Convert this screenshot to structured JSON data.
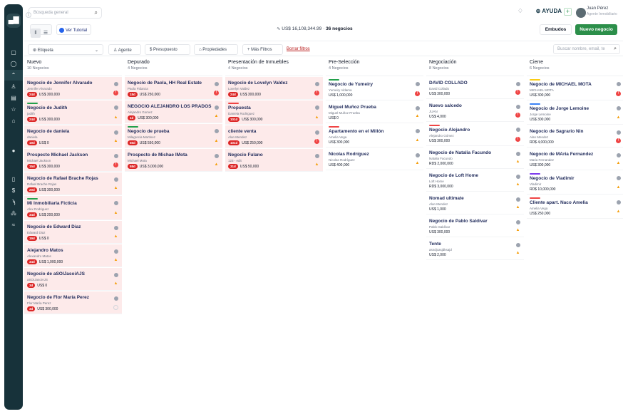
{
  "sidebar": {
    "logo_label": "▄▇",
    "collapse_icon": "chevron-right-icon"
  },
  "header": {
    "search_placeholder": "Búsqueda general",
    "help_label": "AYUDA",
    "user_name": "Juan Pérez",
    "user_role": "Agente Inmobiliario"
  },
  "toolbar": {
    "tutorial_label": "Ver Tutorial",
    "total_value": "US$ 16,108,344.99",
    "total_separator": "·",
    "deal_count": "36 negocios",
    "embudos_label": "Embudos",
    "new_deal_label": "Nuevo negocio"
  },
  "filters": {
    "etiqueta": "Etiqueta",
    "agente": "Agente",
    "presupuesto": "Presupuesto",
    "propiedades": "Propiedades",
    "mas_filtros": "+ Más Filtros",
    "borrar": "Borrar filtros",
    "search_placeholder": "Buscar nombre, email, te"
  },
  "columns": [
    {
      "name": "Nuevo",
      "count": "10 Negocios",
      "cards": [
        {
          "title": "Negocio de Jennifer Alvarado",
          "sub": "Jennifer Alvarado",
          "tag": "24d",
          "value": "US$ 300,000",
          "status": "error",
          "red": true
        },
        {
          "title": "Negocio de Judith",
          "sub": "judith",
          "tag": "24d",
          "value": "US$ 300,000",
          "status": "warn",
          "red": true,
          "bar": "#22a04b"
        },
        {
          "title": "Negocio de daniela",
          "sub": "daniela",
          "tag": "19d",
          "value": "US$ 0",
          "status": "warn",
          "red": true
        },
        {
          "title": "Prospecto Michael Jackson",
          "sub": "Michael Jackson",
          "tag": "15d",
          "value": "US$ 300,000",
          "status": "error",
          "red": true
        },
        {
          "title": "Negocio de Rafael Brache Rojas",
          "sub": "Rafael Brache Rojas",
          "tag": "20d",
          "value": "US$ 300,000",
          "status": "warn",
          "red": true
        },
        {
          "title": "Mi Inmobiliaria Ficticia",
          "sub": "Alex Rodriguez",
          "tag": "34d",
          "value": "US$ 200,000",
          "status": "warn",
          "red": true,
          "bar": "#22a04b"
        },
        {
          "title": "Negocio de Edward Diaz",
          "sub": "Edward Diaz",
          "tag": "19d",
          "value": "US$ 0",
          "status": "warn",
          "red": true
        },
        {
          "title": "Alejandro Matos",
          "sub": "Alexandro Matos",
          "tag": "34d",
          "value": "US$ 1,000,000",
          "status": "warn",
          "red": true
        },
        {
          "title": "Negocio de aSOIJasoiAJS",
          "sub": "aSOIJasoiAJS",
          "tag": "3d",
          "value": "US$ 0",
          "status": "warn",
          "red": true
        },
        {
          "title": "Negocio de Flor María Perez",
          "sub": "Flor María Perez",
          "tag": "3d",
          "value": "US$ 300,000",
          "status": "ok",
          "red": true
        }
      ]
    },
    {
      "name": "Depurado",
      "count": "4 Negocios",
      "cards": [
        {
          "title": "Negocio de Paola, HH Real Estate",
          "sub": "Paola Fidanza",
          "tag": "18d",
          "value": "US$ 250,000",
          "status": "error",
          "red": true
        },
        {
          "title": "NEGOCIO ALEJANDRO LOS PRADOS",
          "sub": "Alejandro Gomez",
          "tag": "1d",
          "value": "US$ 300,000",
          "status": "warn",
          "red": true
        },
        {
          "title": "Negocio de prueba",
          "sub": "Milagrecia Martinez",
          "tag": "55d",
          "value": "US$ 550,000",
          "status": "warn",
          "red": true,
          "bar": "#22a04b"
        },
        {
          "title": "Prospecto de Michae lMota",
          "sub": "Michael Mota",
          "tag": "58d",
          "value": "US$ 3,000,000",
          "status": "warn",
          "red": true
        }
      ]
    },
    {
      "name": "Presentación de Inmuebles",
      "count": "4 Negocios",
      "cards": [
        {
          "title": "Negocio de Lovelyn Valdez",
          "sub": "Lovelyn Valdez",
          "tag": "24d",
          "value": "US$ 300,000",
          "status": "error",
          "red": true
        },
        {
          "title": "Propuesta",
          "sub": "Daniela Rodriguez",
          "tag": "101d",
          "value": "US$ 300,000",
          "status": "warn",
          "red": true,
          "bar": "#ef4444"
        },
        {
          "title": "cliente venta",
          "sub": "Alan Mendez",
          "tag": "101d",
          "value": "US$ 250,000",
          "status": "error",
          "red": true
        },
        {
          "title": "Negocio Fulano",
          "sub": "123 - edit",
          "tag": "31d",
          "value": "US$ 50,000",
          "status": "warn",
          "red": true
        }
      ]
    },
    {
      "name": "Pre-Selección",
      "count": "4 Negocios",
      "cards": [
        {
          "title": "Negocio de Yumeiry",
          "sub": "Yumeiry Aldama",
          "tag": "",
          "value": "US$ 1,000,000",
          "status": "error",
          "red": false,
          "bar": "#22a04b"
        },
        {
          "title": "Miguel Muñoz Prueba",
          "sub": "Miguel Muñoz Prueba",
          "tag": "",
          "value": "US$ 0",
          "status": "warn",
          "red": false
        },
        {
          "title": "Apartamento en el Millón",
          "sub": "Amelia Vega",
          "tag": "",
          "value": "US$ 300,000",
          "status": "warn",
          "red": false,
          "bar": "#ef4444"
        },
        {
          "title": "Nicolas Rodríguez",
          "sub": "Nicolas Rodríguez",
          "tag": "",
          "value": "US$ 400,000",
          "status": "warn",
          "red": false
        }
      ]
    },
    {
      "name": "Negociación",
      "count": "8 Negocios",
      "cards": [
        {
          "title": "DAVID COLLADO",
          "sub": "David Collado",
          "tag": "",
          "value": "US$ 300,000",
          "status": "error",
          "red": false
        },
        {
          "title": "Nuevo salcedo",
          "sub": "JUAN",
          "tag": "",
          "value": "US$ 4,000",
          "status": "error",
          "red": false
        },
        {
          "title": "Negocio Alejandro",
          "sub": "Alejandro Gómez",
          "tag": "",
          "value": "US$ 300,000",
          "status": "error",
          "red": false,
          "bar": "#ef4444"
        },
        {
          "title": "Negocio de Natalia Facundo",
          "sub": "Natalia Facundo",
          "tag": "",
          "value": "RD$ 2,000,000",
          "status": "warn",
          "red": false
        },
        {
          "title": "Negocio de Loft Home",
          "sub": "Loft Home",
          "tag": "",
          "value": "RD$ 3,000,000",
          "status": "warn",
          "red": false
        },
        {
          "title": "Nomad ultimate",
          "sub": "Alan Mendez",
          "tag": "",
          "value": "US$ 1,000",
          "status": "warn",
          "red": false
        },
        {
          "title": "Negocio de Pablo Saldívar",
          "sub": "Pablo Saldívar",
          "tag": "",
          "value": "US$ 300,000",
          "status": "warn",
          "red": false
        },
        {
          "title": "Tente",
          "sub": "asndjcasjdksajd",
          "tag": "",
          "value": "US$ 2,000",
          "status": "warn",
          "red": false
        }
      ]
    },
    {
      "name": "Cierre",
      "count": "6 Negocios",
      "cards": [
        {
          "title": "Negocio de MICHAEL MOTA",
          "sub": "MICHAEL MOTA",
          "tag": "",
          "value": "US$ 300,000",
          "status": "error",
          "red": false,
          "bar": "#facc15"
        },
        {
          "title": "Negocio de Jorge Lemoine",
          "sub": "Jorge Lemoine",
          "tag": "",
          "value": "US$ 300,000",
          "status": "warn",
          "red": false,
          "bar": "#3b82f6"
        },
        {
          "title": "Negocio de Sagrario Nin",
          "sub": "Alan Mendez",
          "tag": "",
          "value": "RD$ 4,000,000",
          "status": "error",
          "red": false
        },
        {
          "title": "Negocio de MAria Fernandez",
          "sub": "Maria Fernandez",
          "tag": "",
          "value": "US$ 300,000",
          "status": "warn",
          "red": false
        },
        {
          "title": "Negocio de Vladimir",
          "sub": "Vladimir",
          "tag": "",
          "value": "RD$ 10,000,000",
          "status": "warn",
          "red": false,
          "bar": "#7c3aed"
        },
        {
          "title": "Cliente apart. Naco Amelia",
          "sub": "Amelia Vega",
          "tag": "",
          "value": "US$ 250,000",
          "status": "warn",
          "red": false,
          "bar": "#ef4444"
        }
      ]
    }
  ]
}
